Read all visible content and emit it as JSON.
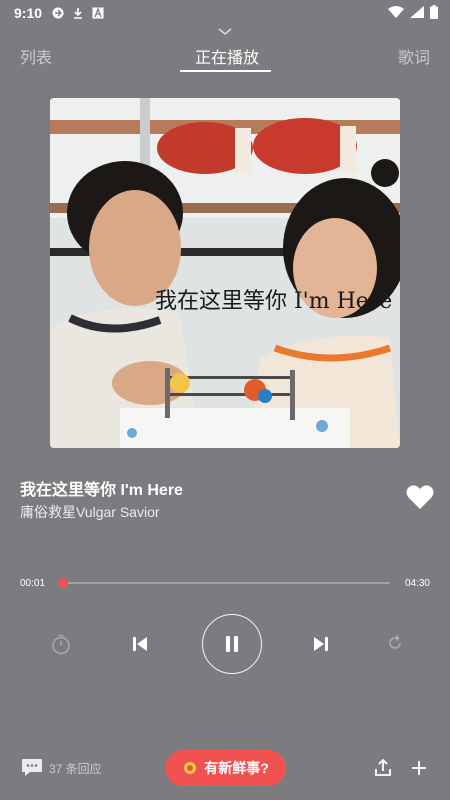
{
  "status_bar": {
    "time": "9:10",
    "icons": [
      "sync-icon",
      "download-icon",
      "font-icon",
      "wifi-icon",
      "signal-icon",
      "battery-icon"
    ]
  },
  "tabs": [
    {
      "label": "列表"
    },
    {
      "label": "正在播放",
      "active": true
    },
    {
      "label": "歌词"
    }
  ],
  "album_art": {
    "overlay_text": "我在这里等你 I'm Here"
  },
  "song": {
    "title": "我在这里等你 I'm Here",
    "artist": "庸俗救星Vulgar Savior",
    "liked": true
  },
  "progress": {
    "current": "00:01",
    "total": "04:30",
    "fraction": 0.004
  },
  "controls": {
    "state": "playing",
    "icons": [
      "timer-icon",
      "previous-icon",
      "pause-icon",
      "next-icon",
      "repeat-icon"
    ]
  },
  "bottom": {
    "comment_count": "37 条回应",
    "news_label": "有新鲜事?",
    "icons": [
      "comment-icon",
      "share-icon",
      "add-icon"
    ]
  },
  "colors": {
    "background": "#7c7c80",
    "accent": "#f0524f",
    "text": "#ffffff"
  }
}
